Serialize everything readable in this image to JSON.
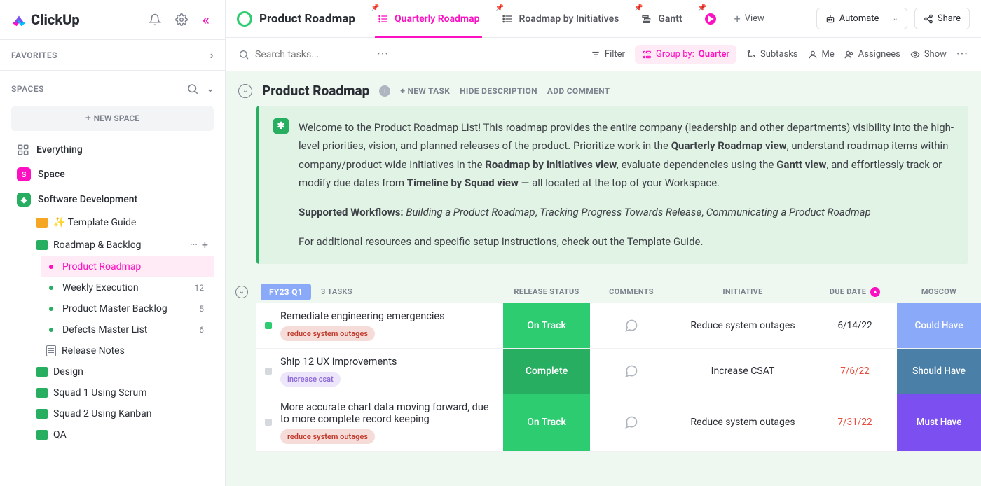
{
  "brand": "ClickUp",
  "sidebar": {
    "favorites_label": "FAVORITES",
    "spaces_label": "SPACES",
    "new_space": "NEW SPACE",
    "everything": "Everything",
    "space": "Space",
    "software_dev": "Software Development",
    "items": [
      {
        "label": "✨ Template Guide"
      },
      {
        "label": "Roadmap & Backlog"
      },
      {
        "label": "Product Roadmap"
      },
      {
        "label": "Weekly Execution",
        "count": "12"
      },
      {
        "label": "Product Master Backlog",
        "count": "5"
      },
      {
        "label": "Defects Master List",
        "count": "6"
      },
      {
        "label": "Release Notes"
      },
      {
        "label": "Design"
      },
      {
        "label": "Squad 1 Using Scrum"
      },
      {
        "label": "Squad 2 Using Kanban"
      },
      {
        "label": "QA"
      }
    ]
  },
  "topbar": {
    "title": "Product Roadmap",
    "tabs": [
      {
        "label": "Quarterly Roadmap"
      },
      {
        "label": "Roadmap by Initiatives"
      },
      {
        "label": "Gantt"
      }
    ],
    "add_view": "View",
    "automate": "Automate",
    "share": "Share"
  },
  "toolbar": {
    "search_placeholder": "Search tasks...",
    "filter": "Filter",
    "group_by_label": "Group by:",
    "group_by_value": "Quarter",
    "subtasks": "Subtasks",
    "me": "Me",
    "assignees": "Assignees",
    "show": "Show"
  },
  "list_header": {
    "title": "Product Roadmap",
    "new_task": "+ NEW TASK",
    "hide_desc": "HIDE DESCRIPTION",
    "add_comment": "ADD COMMENT"
  },
  "description": {
    "p1a": "Welcome to the Product Roadmap List! This roadmap provides the entire company (leadership and other departments) visibility into the high-level priorities, vision, and planned releases of the product. Prioritize work in the ",
    "p1b": "Quarterly Roadmap view",
    "p1c": ", understand roadmap items within company/product-wide initiatives in the ",
    "p1d": "Roadmap by Initiatives view,",
    "p1e": " evaluate dependencies using the ",
    "p1f": "Gantt view",
    "p1g": ", and effortlessly track or modify due dates from ",
    "p1h": "Timeline by Squad view",
    "p1i": " — all located at the top of your Workspace.",
    "p2a": "Supported Workflows:",
    "p2b": "Building a Product Roadmap",
    "p2c": "Tracking Progress Towards Release",
    "p2d": "Communicating a Product Roadmap",
    "p3": "For additional resources and specific setup instructions, check out the Template Guide."
  },
  "group": {
    "chip": "FY23 Q1",
    "count": "3 TASKS",
    "cols": {
      "status": "RELEASE STATUS",
      "comments": "COMMENTS",
      "initiative": "INITIATIVE",
      "due": "DUE DATE",
      "moscow": "MOSCOW"
    }
  },
  "tasks": [
    {
      "title": "Remediate engineering emergencies",
      "tag": "reduce system outages",
      "tag_style": "red",
      "status": "On Track",
      "status_key": "ontrack",
      "initiative": "Reduce system outages",
      "due": "6/14/22",
      "overdue": false,
      "moscow": "Could Have",
      "moscow_key": "could",
      "sq": "ontrack"
    },
    {
      "title": "Ship 12 UX improvements",
      "tag": "increase csat",
      "tag_style": "purple",
      "status": "Complete",
      "status_key": "complete",
      "initiative": "Increase CSAT",
      "due": "7/6/22",
      "overdue": true,
      "moscow": "Should Have",
      "moscow_key": "should",
      "sq": "complete"
    },
    {
      "title": "More accurate chart data moving forward, due to more complete record keeping",
      "tag": "reduce system outages",
      "tag_style": "red",
      "status": "On Track",
      "status_key": "ontrack",
      "initiative": "Reduce system outages",
      "due": "7/31/22",
      "overdue": true,
      "moscow": "Must Have",
      "moscow_key": "must",
      "sq": "complete"
    }
  ]
}
